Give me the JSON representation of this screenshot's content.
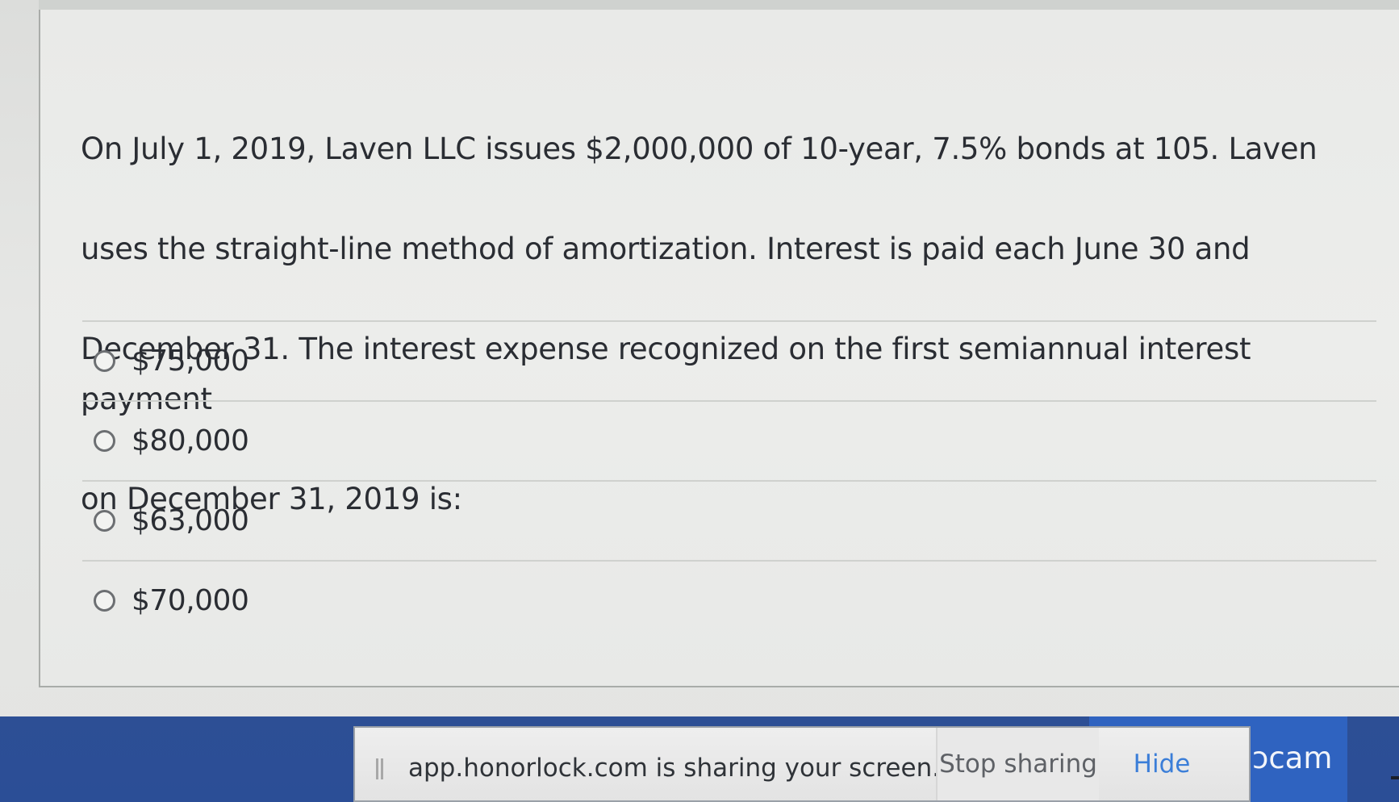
{
  "question": {
    "text": "On July 1, 2019, Laven LLC issues $2,000,000 of 10-year, 7.5% bonds at 105.  Laven uses the straight-line method of amortization.  Interest is paid each June 30 and December 31. The interest expense recognized on the first semiannual interest payment on December 31, 2019 is:",
    "lines": [
      "On July 1, 2019, Laven LLC issues $2,000,000 of 10-year, 7.5% bonds at 105.  Laven",
      "uses the straight-line method of amortization.  Interest is paid each June 30 and",
      "December 31. The interest expense recognized on the first semiannual interest payment",
      "on December 31, 2019 is:"
    ]
  },
  "answers": [
    {
      "label": "$75,000"
    },
    {
      "label": "$80,000"
    },
    {
      "label": "$63,000"
    },
    {
      "label": "$70,000"
    }
  ],
  "share_bar": {
    "message": "app.honorlock.com is sharing your screen.",
    "stop_label": "Stop sharing",
    "hide_label": "Hide",
    "webcam_label": "ɔcam",
    "pause_icon": "pause-icon"
  },
  "colors": {
    "panel_background": "#ebecea",
    "text": "#2a2d33",
    "share_bar": "#2b4e96",
    "hide_link": "#3b7ed8"
  }
}
